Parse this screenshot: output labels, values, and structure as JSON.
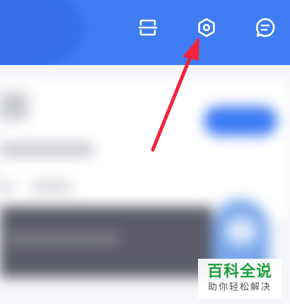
{
  "header": {
    "background_color": "#3f7cf3",
    "icons": {
      "scan": "scan-icon",
      "settings": "settings-hexagon-icon",
      "message": "message-icon"
    }
  },
  "annotation": {
    "arrow_color": "#f2233b",
    "points_to": "settings-hexagon-icon"
  },
  "content": {
    "accent_color": "#3f7cf3"
  },
  "watermark": {
    "title": "百科全说",
    "subtitle": "助你轻松解决",
    "title_color": "#1e9e3a"
  }
}
